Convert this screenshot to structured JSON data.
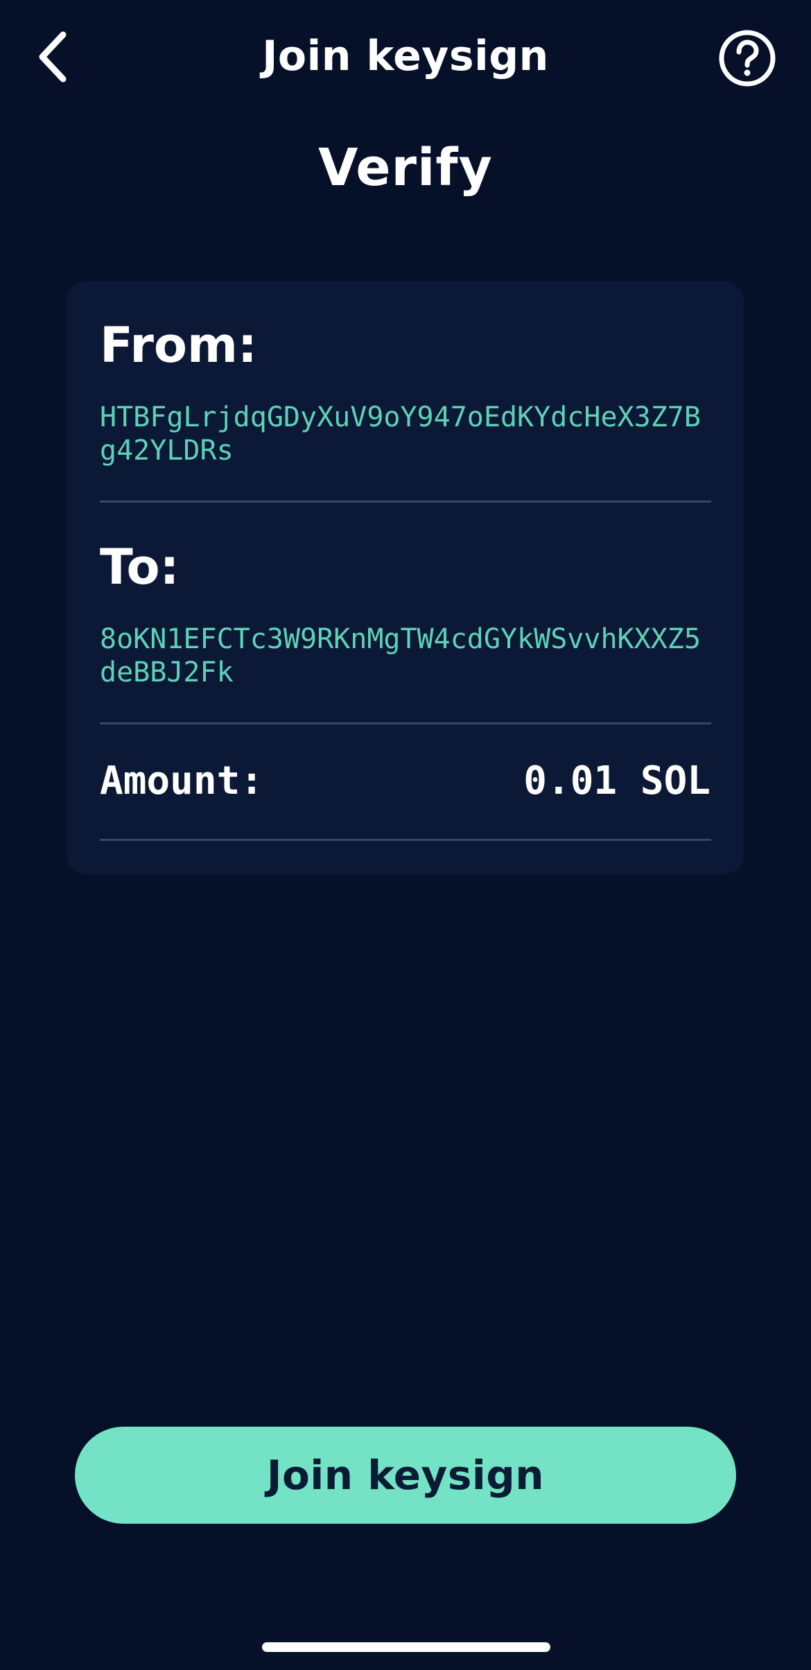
{
  "header": {
    "title": "Join keysign",
    "back_icon": "chevron-left-icon",
    "help_icon": "question-circle-icon"
  },
  "page": {
    "heading": "Verify"
  },
  "transaction": {
    "from_label": "From:",
    "from_address": "HTBFgLrjdqGDyXuV9oY947oEdKYdcHeX3Z7Bg42YLDRs",
    "to_label": "To:",
    "to_address": "8oKN1EFCTc3W9RKnMgTW4cdGYkWSvvhKXXZ5deBBJ2Fk",
    "amount_label": "Amount:",
    "amount_value": "0.01 SOL"
  },
  "actions": {
    "join_label": "Join keysign"
  },
  "colors": {
    "background": "#061029",
    "card": "#0c1936",
    "accent": "#74e3c5",
    "address_text": "#5ed2b6",
    "divider": "#3a4863"
  }
}
